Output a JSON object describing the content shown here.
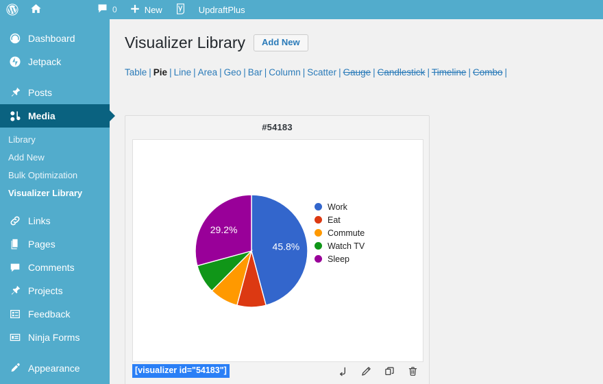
{
  "adminbar": {
    "items": [
      {
        "name": "wordpress-logo",
        "icon": "wordpress-icon",
        "label": ""
      },
      {
        "name": "site-home",
        "icon": "home-icon",
        "label": ""
      },
      {
        "name": "comments",
        "icon": "comment-icon",
        "label": "0"
      },
      {
        "name": "new-content",
        "icon": "plus-icon",
        "label": "New"
      },
      {
        "name": "yoast-seo",
        "icon": "yoast-icon",
        "label": ""
      },
      {
        "name": "updraftplus",
        "icon": "",
        "label": "UpdraftPlus"
      }
    ],
    "comment_count": "0",
    "new_label": "New",
    "updraft_label": "UpdraftPlus"
  },
  "sidebar": {
    "items": [
      {
        "label": "Dashboard",
        "icon": "dashboard-icon",
        "current": false
      },
      {
        "label": "Jetpack",
        "icon": "jetpack-icon",
        "current": false
      },
      {
        "label": "Posts",
        "icon": "pin-icon",
        "current": false
      },
      {
        "label": "Media",
        "icon": "media-icon",
        "current": true
      },
      {
        "label": "Links",
        "icon": "link-icon",
        "current": false
      },
      {
        "label": "Pages",
        "icon": "pages-icon",
        "current": false
      },
      {
        "label": "Comments",
        "icon": "comment-icon",
        "current": false
      },
      {
        "label": "Projects",
        "icon": "pin-icon",
        "current": false
      },
      {
        "label": "Feedback",
        "icon": "feedback-icon",
        "current": false
      },
      {
        "label": "Ninja Forms",
        "icon": "forms-icon",
        "current": false
      },
      {
        "label": "Appearance",
        "icon": "appearance-icon",
        "current": false
      }
    ],
    "submenu": [
      {
        "label": "Library",
        "current": false
      },
      {
        "label": "Add New",
        "current": false
      },
      {
        "label": "Bulk Optimization",
        "current": false
      },
      {
        "label": "Visualizer Library",
        "current": true
      }
    ]
  },
  "page": {
    "title": "Visualizer Library",
    "add_new_label": "Add New"
  },
  "tabs": [
    {
      "label": "Table",
      "state": "normal"
    },
    {
      "label": "Pie",
      "state": "active"
    },
    {
      "label": "Line",
      "state": "normal"
    },
    {
      "label": "Area",
      "state": "normal"
    },
    {
      "label": "Geo",
      "state": "normal"
    },
    {
      "label": "Bar",
      "state": "normal"
    },
    {
      "label": "Column",
      "state": "normal"
    },
    {
      "label": "Scatter",
      "state": "normal"
    },
    {
      "label": "Gauge",
      "state": "disabled"
    },
    {
      "label": "Candlestick",
      "state": "disabled"
    },
    {
      "label": "Timeline",
      "state": "disabled"
    },
    {
      "label": "Combo",
      "state": "disabled"
    }
  ],
  "card": {
    "title": "#54183",
    "shortcode": "[visualizer id=\"54183\"]",
    "actions": [
      {
        "name": "export-action",
        "icon": "arrow-return-icon"
      },
      {
        "name": "edit-action",
        "icon": "pencil-icon"
      },
      {
        "name": "clone-action",
        "icon": "copy-icon"
      },
      {
        "name": "delete-action",
        "icon": "trash-icon"
      }
    ]
  },
  "chart_data": {
    "type": "pie",
    "title": "#54183",
    "categories": [
      "Work",
      "Eat",
      "Commute",
      "Watch TV",
      "Sleep"
    ],
    "values": [
      11,
      2,
      2,
      2,
      7
    ],
    "percentages": [
      45.8,
      8.3,
      8.3,
      8.3,
      29.2
    ],
    "displayed_labels": [
      {
        "category": "Work",
        "text": "45.8%"
      },
      {
        "category": "Sleep",
        "text": "29.2%"
      }
    ],
    "colors": [
      "#3366cc",
      "#dc3912",
      "#ff9900",
      "#109618",
      "#990099"
    ],
    "legend": {
      "position": "right",
      "entries": [
        "Work",
        "Eat",
        "Commute",
        "Watch TV",
        "Sleep"
      ]
    },
    "grid": false
  }
}
